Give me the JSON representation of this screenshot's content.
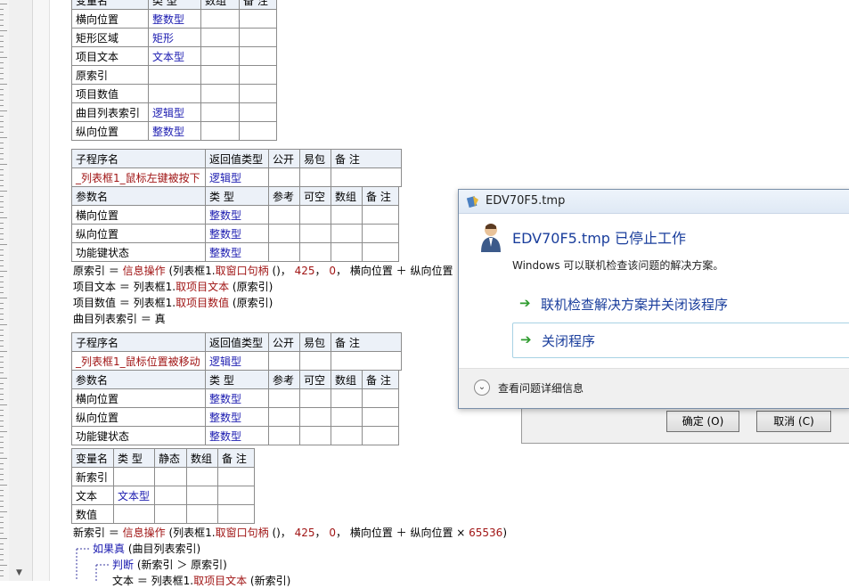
{
  "vars_table": {
    "header": [
      "变量名",
      "类 型",
      "数组",
      "备 注"
    ],
    "rows": [
      {
        "name": "横向位置",
        "type": "整数型"
      },
      {
        "name": "矩形区域",
        "type": "矩形"
      },
      {
        "name": "项目文本",
        "type": "文本型"
      },
      {
        "name": "原索引",
        "type": ""
      },
      {
        "name": "项目数值",
        "type": ""
      },
      {
        "name": "曲目列表索引",
        "type": "逻辑型"
      },
      {
        "name": "纵向位置",
        "type": "整数型"
      }
    ]
  },
  "sub1": {
    "header": [
      "子程序名",
      "返回值类型",
      "公开",
      "易包",
      "备 注"
    ],
    "name": "_列表框1_鼠标左键被按下",
    "return_type": "逻辑型",
    "param_header": [
      "参数名",
      "类 型",
      "参考",
      "可空",
      "数组",
      "备 注"
    ],
    "params": [
      {
        "name": "横向位置",
        "type": "整数型"
      },
      {
        "name": "纵向位置",
        "type": "整数型"
      },
      {
        "name": "功能键状态",
        "type": "整数型"
      }
    ]
  },
  "code1": [
    [
      "原索引 ＝ ",
      "信息操作",
      " (列表框1.",
      "取窗口句柄",
      " ()， ",
      "425",
      "， ",
      "0",
      "， 横向位置 ＋ 纵向位置"
    ],
    [
      "项目文本 ＝ 列表框1.",
      "取项目文本",
      " (原索引)"
    ],
    [
      "项目数值 ＝ 列表框1.",
      "取项目数值",
      " (原索引)"
    ],
    [
      "曲目列表索引 ＝ 真"
    ]
  ],
  "sub2": {
    "header": [
      "子程序名",
      "返回值类型",
      "公开",
      "易包",
      "备 注"
    ],
    "name": "_列表框1_鼠标位置被移动",
    "return_type": "逻辑型",
    "param_header": [
      "参数名",
      "类 型",
      "参考",
      "可空",
      "数组",
      "备 注"
    ],
    "params": [
      {
        "name": "横向位置",
        "type": "整数型"
      },
      {
        "name": "纵向位置",
        "type": "整数型"
      },
      {
        "name": "功能键状态",
        "type": "整数型"
      }
    ]
  },
  "locals": {
    "header": [
      "变量名",
      "类 型",
      "静态",
      "数组",
      "备 注"
    ],
    "rows": [
      {
        "name": "新索引",
        "type": ""
      },
      {
        "name": "文本",
        "type": "文本型"
      },
      {
        "name": "数值",
        "type": ""
      }
    ]
  },
  "code2": {
    "line1_a": "新索引 ＝ ",
    "line1_fn": "信息操作",
    "line1_b": " (列表框1.",
    "line1_fn2": "取窗口句柄",
    "line1_c": " ()， ",
    "line1_n1": "425",
    "line1_d": "， ",
    "line1_n2": "0",
    "line1_e": "， 横向位置 ＋ 纵向位置 × ",
    "line1_n3": "65536",
    "line1_f": ")",
    "if_kw": "如果真",
    "if_arg": " (曲目列表索引)",
    "judge_kw": "判断",
    "judge_arg": " (新索引 ＞ 原索引)",
    "line4_a": "文本 ＝ 列表框1.",
    "line4_fn": "取项目文本",
    "line4_b": " (新索引)"
  },
  "background_dialog": {
    "ok_label": "确定 (O)",
    "cancel_label": "取消 (C)"
  },
  "error_dialog": {
    "title": "EDV70F5.tmp",
    "headline": "EDV70F5.tmp 已停止工作",
    "subtitle": "Windows 可以联机检查该问题的解决方案。",
    "option1": "联机检查解决方案并关闭该程序",
    "option2": "关闭程序",
    "details": "查看问题详细信息"
  },
  "colors": {
    "type_blue": "#1b1bb0",
    "keyword_red": "#a01515",
    "option_blue": "#1a3e9c",
    "arrow_green": "#2e9b2e"
  }
}
